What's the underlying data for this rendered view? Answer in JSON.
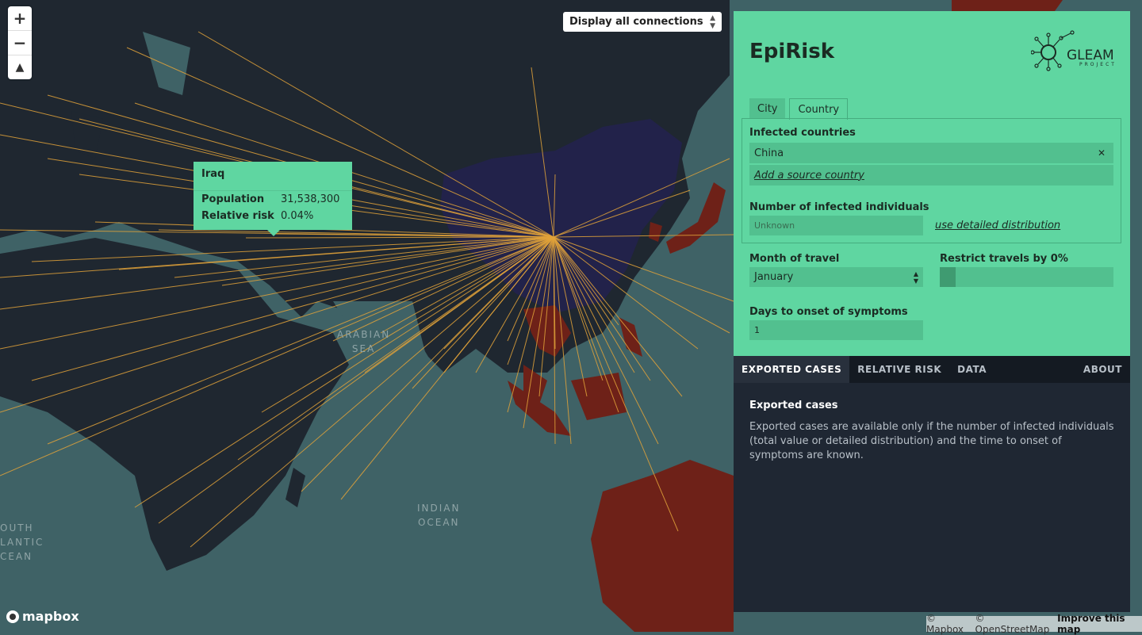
{
  "map": {
    "colors": {
      "ocean": "#3f6266",
      "land": "#1f2730",
      "source_country": "#22224a",
      "risk_country": "#6e2118",
      "connection": "#e0a23a"
    },
    "labels": [
      {
        "id": "arabian",
        "text": "ARABIAN\nSEA"
      },
      {
        "id": "indian",
        "text": "INDIAN\nOCEAN"
      },
      {
        "id": "atlantic",
        "text": "OUTH\nLANTIC\nCEAN"
      }
    ]
  },
  "controls": {
    "zoom_in": "+",
    "zoom_out": "−",
    "compass": "▲",
    "connections_select": "Display all connections"
  },
  "tooltip": {
    "title": "Iraq",
    "population_label": "Population",
    "population_value": "31,538,300",
    "risk_label": "Relative risk",
    "risk_value": "0.04%"
  },
  "panel": {
    "title": "EpiRisk",
    "logo_text": "GLEAM",
    "logo_sub": "PROJECT",
    "tabs": [
      "City",
      "Country"
    ],
    "active_tab": "Country",
    "infected_label": "Infected countries",
    "infected_value": "China",
    "add_source": "Add a source country",
    "num_infected_label": "Number of infected individuals",
    "num_infected_placeholder": "Unknown",
    "detailed_link": "use detailed distribution",
    "month_label": "Month of travel",
    "month_value": "January",
    "restrict_label": "Restrict travels by 0%",
    "restrict_value": 0,
    "days_label": "Days to onset of symptoms",
    "days_value": "1",
    "bottom_tabs": [
      "EXPORTED CASES",
      "RELATIVE RISK",
      "DATA"
    ],
    "about": "ABOUT",
    "content_title": "Exported cases",
    "content_text": "Exported cases are available only if the number of infected individuals (total value or detailed distribution) and the time to onset of symptoms are known."
  },
  "footer": {
    "mapbox": "mapbox",
    "attribution_1": "© Mapbox",
    "attribution_2": "© OpenStreetMap",
    "attribution_3": "Improve this map"
  }
}
